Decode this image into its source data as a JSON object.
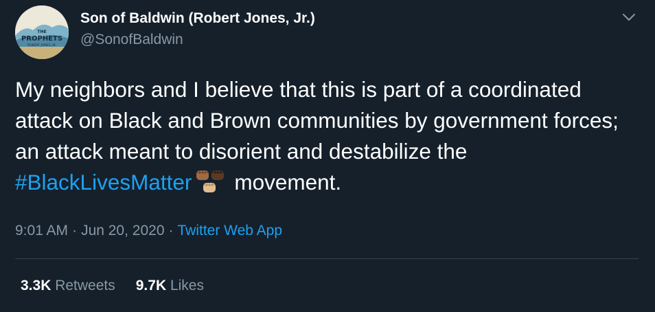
{
  "author": {
    "display_name": "Son of Baldwin (Robert Jones, Jr.)",
    "handle": "@SonofBaldwin",
    "avatar": {
      "line1": "THE",
      "line2": "PROPHETS",
      "line3": "ROBERT JONES, JR."
    }
  },
  "tweet": {
    "text_before": "My neighbors and I believe that this is part of a coordinated attack on Black and Brown communities by government forces; an attack meant to disorient and destabilize the ",
    "hashtag": "#BlackLivesMatter",
    "text_after": "movement.",
    "emoji": "raised-fists-emoji"
  },
  "meta": {
    "time": "9:01 AM",
    "separator": "·",
    "date": "Jun 20, 2020",
    "source": "Twitter Web App"
  },
  "stats": {
    "retweets_count": "3.3K",
    "retweets_label": "Retweets",
    "likes_count": "9.7K",
    "likes_label": "Likes"
  },
  "colors": {
    "background": "#15202b",
    "text": "#ffffff",
    "secondary": "#8899a6",
    "accent": "#1da1f2",
    "divider": "#38444d"
  }
}
